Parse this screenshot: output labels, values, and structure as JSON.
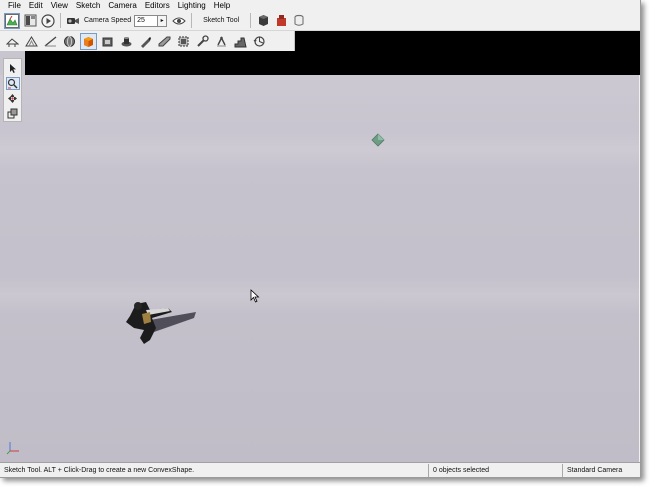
{
  "menu": [
    "File",
    "Edit",
    "View",
    "Sketch",
    "Camera",
    "Editors",
    "Lighting",
    "Help"
  ],
  "toolbar": {
    "camera_speed_label": "Camera Speed",
    "camera_speed_value": "25",
    "sketch_tool_label": "Sketch Tool",
    "icons": [
      "terrain-editor-icon",
      "gui-editor-icon",
      "play-icon",
      "camera-icon",
      "speed-arrow-icon",
      "visibility-eye-icon",
      "material-sphere-icon",
      "shape-icon",
      "database-icon"
    ]
  },
  "toolbar2_icons": [
    "box-tool-icon",
    "triangle-tool-icon",
    "line-tool-icon",
    "sphere-tool-icon",
    "cube-tool-icon",
    "extrude-tool-icon",
    "hollow-tool-icon",
    "pen-tool-icon",
    "bevel-tool-icon",
    "select-face-icon",
    "wrench-tool-icon",
    "clip-tool-icon",
    "stairs-tool-icon",
    "camera-orbit-icon"
  ],
  "side_tools": [
    "select-arrow-icon",
    "zoom-icon",
    "move-icon",
    "scale-icon"
  ],
  "status": {
    "message": "Sketch Tool.  ALT + Click-Drag to create a new ConvexShape.",
    "selection": "0 objects selected",
    "camera": "Standard Camera"
  },
  "colors": {
    "viewport": "#c6c2cd",
    "accent": "#7a9cc4",
    "marker": "#6f9c84"
  }
}
